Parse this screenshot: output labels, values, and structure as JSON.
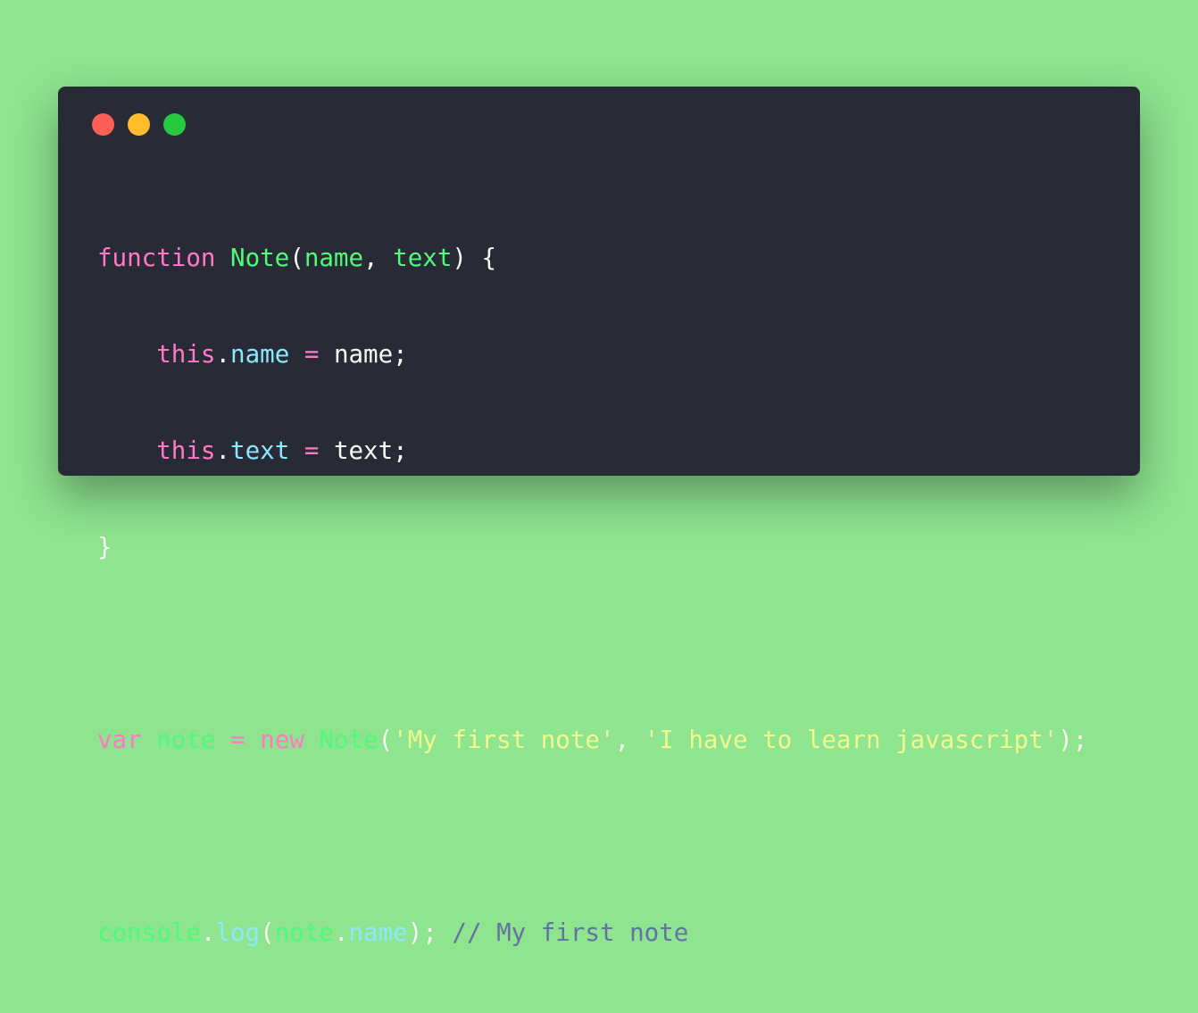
{
  "window": {
    "controls": {
      "close_icon": "close-dot",
      "minimize_icon": "minimize-dot",
      "maximize_icon": "maximize-dot",
      "colors": {
        "close": "#ff5f56",
        "minimize": "#ffbd2e",
        "maximize": "#27c93f"
      }
    }
  },
  "theme": {
    "background": "#8ee48f",
    "editor_bg": "#282a36",
    "keyword": "#ff79c6",
    "function": "#50fa7b",
    "property": "#8be9fd",
    "string": "#f1fa8c",
    "comment": "#6272a4",
    "text": "#f8f8f2"
  },
  "code": {
    "line1": {
      "kw_function": "function",
      "name_Note": "Note",
      "paren_open": "(",
      "param_name": "name",
      "comma": ", ",
      "param_text": "text",
      "paren_close_brace": ") {"
    },
    "line2": {
      "indent": "    ",
      "this": "this",
      "dot": ".",
      "prop": "name",
      "eq": " = ",
      "value": "name;"
    },
    "line3": {
      "indent": "    ",
      "this": "this",
      "dot": ".",
      "prop": "text",
      "eq": " = ",
      "value": "text;"
    },
    "line4": {
      "close_brace": "}"
    },
    "line6": {
      "kw_var": "var",
      "var_note": "note",
      "eq": " = ",
      "kw_new": "new",
      "ctor_Note": "Note",
      "paren_open": "(",
      "str1": "'My first note'",
      "comma": ", ",
      "str2": "'I have to learn javascript'",
      "end": ");"
    },
    "line8": {
      "console": "console",
      "dot1": ".",
      "log": "log",
      "paren_open": "(",
      "arg_note": "note",
      "dot2": ".",
      "arg_prop": "name",
      "end": "); ",
      "comment": "// My first note"
    }
  }
}
